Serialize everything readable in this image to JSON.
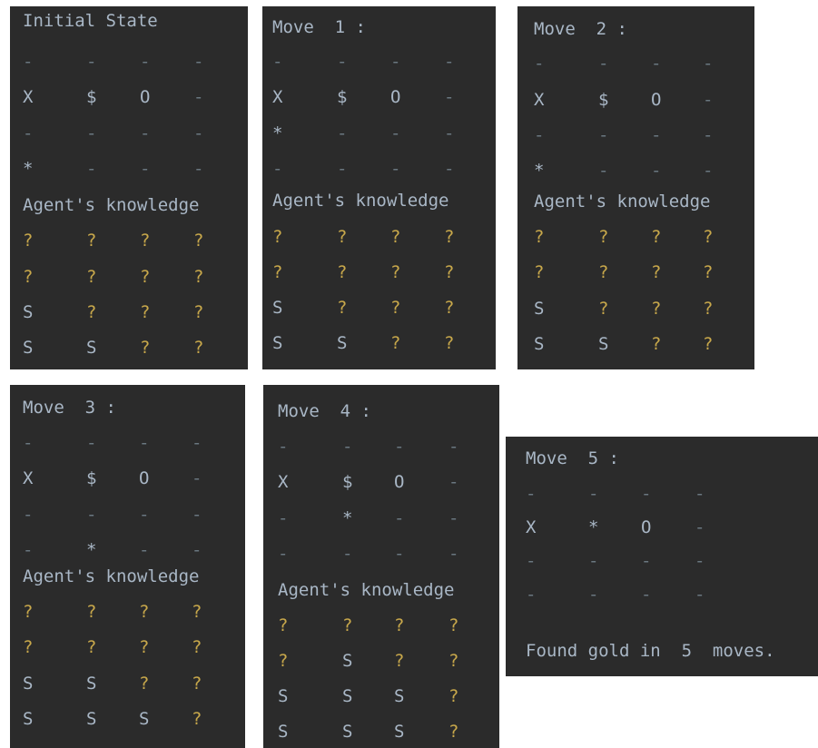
{
  "panels": [
    {
      "title": "Initial State",
      "grid": [
        [
          "-",
          "-",
          "-",
          "-"
        ],
        [
          "X",
          "$",
          "O",
          "-"
        ],
        [
          "-",
          "-",
          "-",
          "-"
        ],
        [
          "*",
          "-",
          "-",
          "-"
        ]
      ],
      "knowledge_label": "Agent's knowledge",
      "knowledge": [
        [
          "?",
          "?",
          "?",
          "?"
        ],
        [
          "?",
          "?",
          "?",
          "?"
        ],
        [
          "S",
          "?",
          "?",
          "?"
        ],
        [
          "S",
          "S",
          "?",
          "?"
        ]
      ]
    },
    {
      "title": "Move  1 :",
      "grid": [
        [
          "-",
          "-",
          "-",
          "-"
        ],
        [
          "X",
          "$",
          "O",
          "-"
        ],
        [
          "*",
          "-",
          "-",
          "-"
        ],
        [
          "-",
          "-",
          "-",
          "-"
        ]
      ],
      "knowledge_label": "Agent's knowledge",
      "knowledge": [
        [
          "?",
          "?",
          "?",
          "?"
        ],
        [
          "?",
          "?",
          "?",
          "?"
        ],
        [
          "S",
          "?",
          "?",
          "?"
        ],
        [
          "S",
          "S",
          "?",
          "?"
        ]
      ]
    },
    {
      "title": "Move  2 :",
      "grid": [
        [
          "-",
          "-",
          "-",
          "-"
        ],
        [
          "X",
          "$",
          "O",
          "-"
        ],
        [
          "-",
          "-",
          "-",
          "-"
        ],
        [
          "*",
          "-",
          "-",
          "-"
        ]
      ],
      "knowledge_label": "Agent's knowledge",
      "knowledge": [
        [
          "?",
          "?",
          "?",
          "?"
        ],
        [
          "?",
          "?",
          "?",
          "?"
        ],
        [
          "S",
          "?",
          "?",
          "?"
        ],
        [
          "S",
          "S",
          "?",
          "?"
        ]
      ]
    },
    {
      "title": "Move  3 :",
      "grid": [
        [
          "-",
          "-",
          "-",
          "-"
        ],
        [
          "X",
          "$",
          "O",
          "-"
        ],
        [
          "-",
          "-",
          "-",
          "-"
        ],
        [
          "-",
          "*",
          "-",
          "-"
        ]
      ],
      "knowledge_label": "Agent's knowledge",
      "knowledge": [
        [
          "?",
          "?",
          "?",
          "?"
        ],
        [
          "?",
          "?",
          "?",
          "?"
        ],
        [
          "S",
          "S",
          "?",
          "?"
        ],
        [
          "S",
          "S",
          "S",
          "?"
        ]
      ]
    },
    {
      "title": "Move  4 :",
      "grid": [
        [
          "-",
          "-",
          "-",
          "-"
        ],
        [
          "X",
          "$",
          "O",
          "-"
        ],
        [
          "-",
          "*",
          "-",
          "-"
        ],
        [
          "-",
          "-",
          "-",
          "-"
        ]
      ],
      "knowledge_label": "Agent's knowledge",
      "knowledge": [
        [
          "?",
          "?",
          "?",
          "?"
        ],
        [
          "?",
          "S",
          "?",
          "?"
        ],
        [
          "S",
          "S",
          "S",
          "?"
        ],
        [
          "S",
          "S",
          "S",
          "?"
        ]
      ]
    },
    {
      "title": "Move  5 :",
      "grid": [
        [
          "-",
          "-",
          "-",
          "-"
        ],
        [
          "X",
          "*",
          "O",
          "-"
        ],
        [
          "-",
          "-",
          "-",
          "-"
        ],
        [
          "-",
          "-",
          "-",
          "-"
        ]
      ],
      "footer": "Found gold in  5  moves."
    }
  ]
}
